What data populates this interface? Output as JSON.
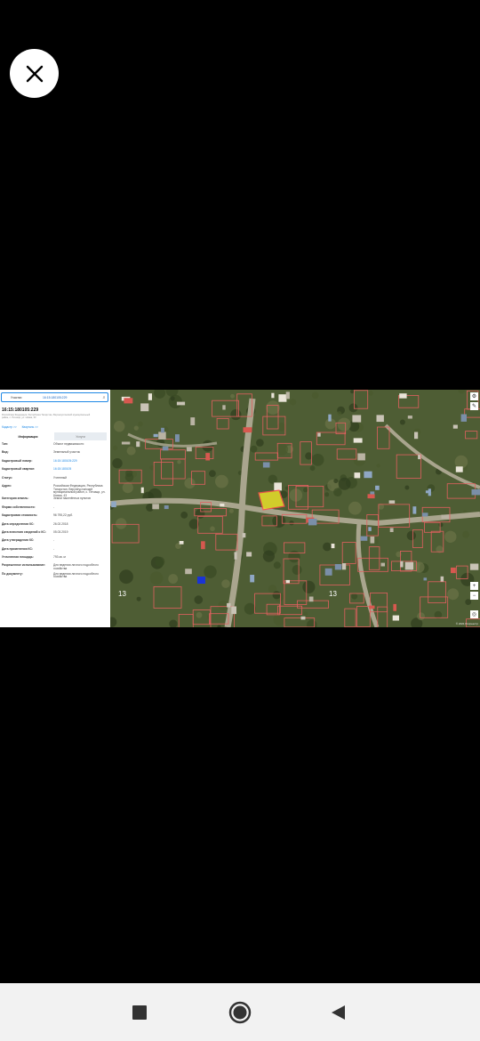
{
  "viewer": {
    "close_icon": "close-icon"
  },
  "screenshot": {
    "panel": {
      "search_type": "Участки",
      "search_value": "16:15:180105:229",
      "object_title": "16:15:180105:229",
      "object_subtitle": "Российская Федерация, Республика Татарстан, Верхнеуслонский муниципальный район, с. Печищи, ул. Новая, 43",
      "links": [
        "Кадастр >>",
        "Кварталь >>"
      ],
      "tabs": {
        "info": "Информация",
        "services": "Услуги"
      },
      "rows": [
        {
          "k": "Тип:",
          "v": "Объект недвижимости",
          "link": false
        },
        {
          "k": "Вид:",
          "v": "Земельный участок",
          "link": false
        },
        {
          "k": "Кадастровый номер:",
          "v": "16:15:180105:229",
          "link": true
        },
        {
          "k": "Кадастровый квартал:",
          "v": "16:15:180105",
          "link": true
        },
        {
          "k": "Статус:",
          "v": "Учтенный",
          "link": false
        },
        {
          "k": "Адрес:",
          "v": "Российская Федерация, Республика Татарстан, Верхнеуслонский муниципальный район, с. Печищи, ул. Новая, 43",
          "link": false
        },
        {
          "k": "Категория земель:",
          "v": "Земли населённых пунктов",
          "link": false
        },
        {
          "k": "Форма собственности:",
          "v": "-",
          "link": false
        },
        {
          "k": "Кадастровая стоимость:",
          "v": "96 795,22 руб.",
          "link": false
        },
        {
          "k": "Дата определения КС:",
          "v": "26.02.2018",
          "link": false
        },
        {
          "k": "Дата внесения сведений о КС:",
          "v": "05.03.2019",
          "link": false
        },
        {
          "k": "Дата утверждения КС:",
          "v": "-",
          "link": false
        },
        {
          "k": "Дата применения КС:",
          "v": "-",
          "link": false
        },
        {
          "k": "Уточненная площадь:",
          "v": "793 кв. м",
          "link": false
        },
        {
          "k": "Разрешенное использование:",
          "v": "Для ведения личного подсобного хозяйства",
          "link": false
        },
        {
          "k": "По документу:",
          "v": "Для ведения личного подсобного хозяйства",
          "link": false
        }
      ]
    },
    "map": {
      "parcel_labels": [
        "13",
        "13"
      ],
      "zoom_in": "+",
      "zoom_out": "−",
      "attribution": "© 2021 Росреестр",
      "highlight_color": "#e8e02a",
      "boundary_color": "#e0605f"
    }
  },
  "navbar": {
    "recents_icon": "square-icon",
    "home_icon": "circle-icon",
    "back_icon": "triangle-back-icon"
  }
}
